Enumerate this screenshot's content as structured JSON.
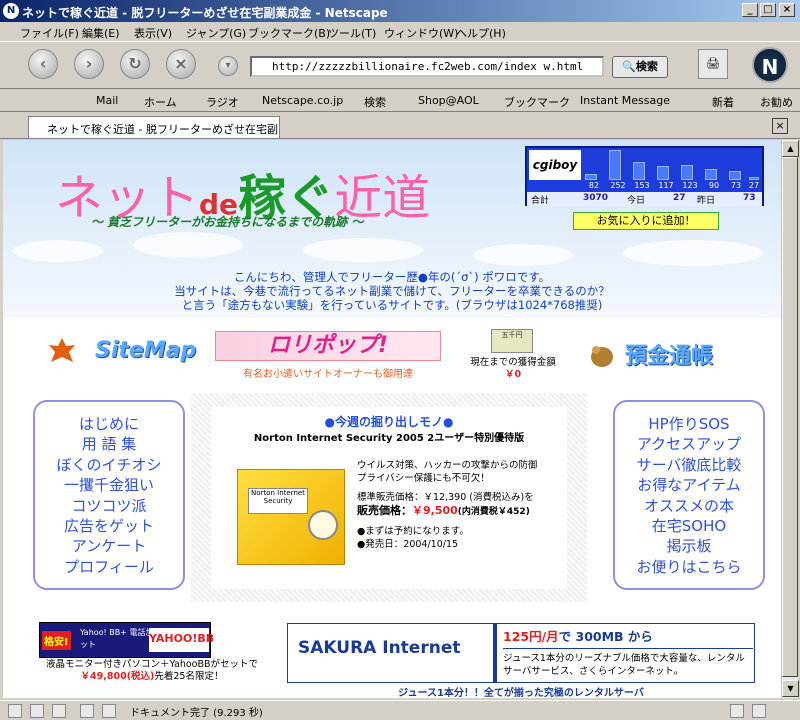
{
  "window": {
    "title": "ネットで稼ぐ近道 - 脱フリーターめざせ在宅副業成金 - Netscape"
  },
  "menu": [
    "ファイル(F)",
    "編集(E)",
    "表示(V)",
    "ジャンプ(G)",
    "ブックマーク(B)",
    "ツール(T)",
    "ウィンドウ(W)",
    "ヘルプ(H)"
  ],
  "navbar": {
    "url": "http://zzzzzbillionaire.fc2web.com/index w.html",
    "search_label": "検索"
  },
  "bookmarks": [
    "Mail",
    "ホーム",
    "ラジオ",
    "Netscape.co.jp",
    "検索",
    "Shop@AOL",
    "ブックマーク",
    "Instant Message",
    "新着",
    "お勧め"
  ],
  "tab": {
    "label": "ネットで稼ぐ近道 - 脱フリーターめざせ在宅副..."
  },
  "page": {
    "title_part1": "ネット",
    "title_part2": "de",
    "title_part3": "稼ぐ",
    "title_part4": "近道",
    "tagline": "～ 貧乏フリーターがお金持ちになるまでの軌跡 ～",
    "intro_lines": [
      "こんにちわ、管理人でフリーター歴●年の(´σ`) ポワロです。",
      "当サイトは、今巷で流行ってるネット副業で儲けて、フリーターを卒業できるのか？",
      "と言う「途方もない実験」を行っているサイトです。(ブラウザは1024*768推奨)"
    ],
    "counter": {
      "logo": "cgiboy",
      "daily": [
        "82",
        "252",
        "153",
        "117",
        "123",
        "90",
        "73",
        "27"
      ],
      "total_label": "合計",
      "total": "3070",
      "today_label": "今日",
      "today": "27",
      "yesterday_label": "昨日",
      "yesterday": "73"
    },
    "favorite_label": "お気に入りに追加！",
    "sitemap": "SiteMap",
    "lolipop": "ロリポップ!",
    "lolipop_caption": "有名お小遣いサイトオーナーも御用達",
    "money_img": "五千円",
    "money_caption": "現在までの獲得金額",
    "money_value": "￥0",
    "bankbook": "預金通帳",
    "left_nav": [
      "はじめに",
      "用 語 集",
      "ぼくのイチオシ",
      "一攫千金狙い",
      "コツコツ派",
      "広告をゲット",
      "アンケート",
      "プロフィール"
    ],
    "right_nav": [
      "HP作りSOS",
      "アクセスアップ",
      "サーバ徹底比較",
      "お得なアイテム",
      "オススメの本",
      "在宅SOHO",
      "掲示板",
      "お便りはこちら"
    ],
    "feature": {
      "title": "●今週の掘り出しモノ●",
      "name": "Norton Internet Security 2005 2ユーザー特別優待版",
      "box_label": "Norton Internet Security",
      "desc1": "ウイルス対策、ハッカーの攻撃からの防御",
      "desc2": "プライバシー保護にも不可欠！",
      "std_price": "標準販売価格：￥12,390 (消費税込み)を",
      "sale_label": "販売価格：",
      "sale_price": "￥9,500",
      "sale_tax": "(内消費税￥452)",
      "note1": "●まずは予約になります。",
      "note2": "●発売日：2004/10/15"
    },
    "yahoo_ad": {
      "badge": "格安!",
      "text": "Yahoo! BB+ 電話加入権セット",
      "logo": "YAHOO!BB",
      "caption1": "液晶モニター付きパソコン＋YahooBBがセットで",
      "caption_price": "￥49,800(税込)",
      "caption2": "先着25名限定！"
    },
    "sakura_ad": {
      "logo": "SAKURA Internet",
      "head_price": "125円/月",
      "head_rest": "で 300MB から",
      "body": "ジュース1本分のリーズナブル価格で大容量な、レンタルサーバサービス、さくらインターネット。",
      "caption": "ジュース1本分！！全てが揃った究極のレンタルサーバ"
    }
  },
  "status": {
    "text": "ドキュメント完了 (9.293 秒)"
  }
}
